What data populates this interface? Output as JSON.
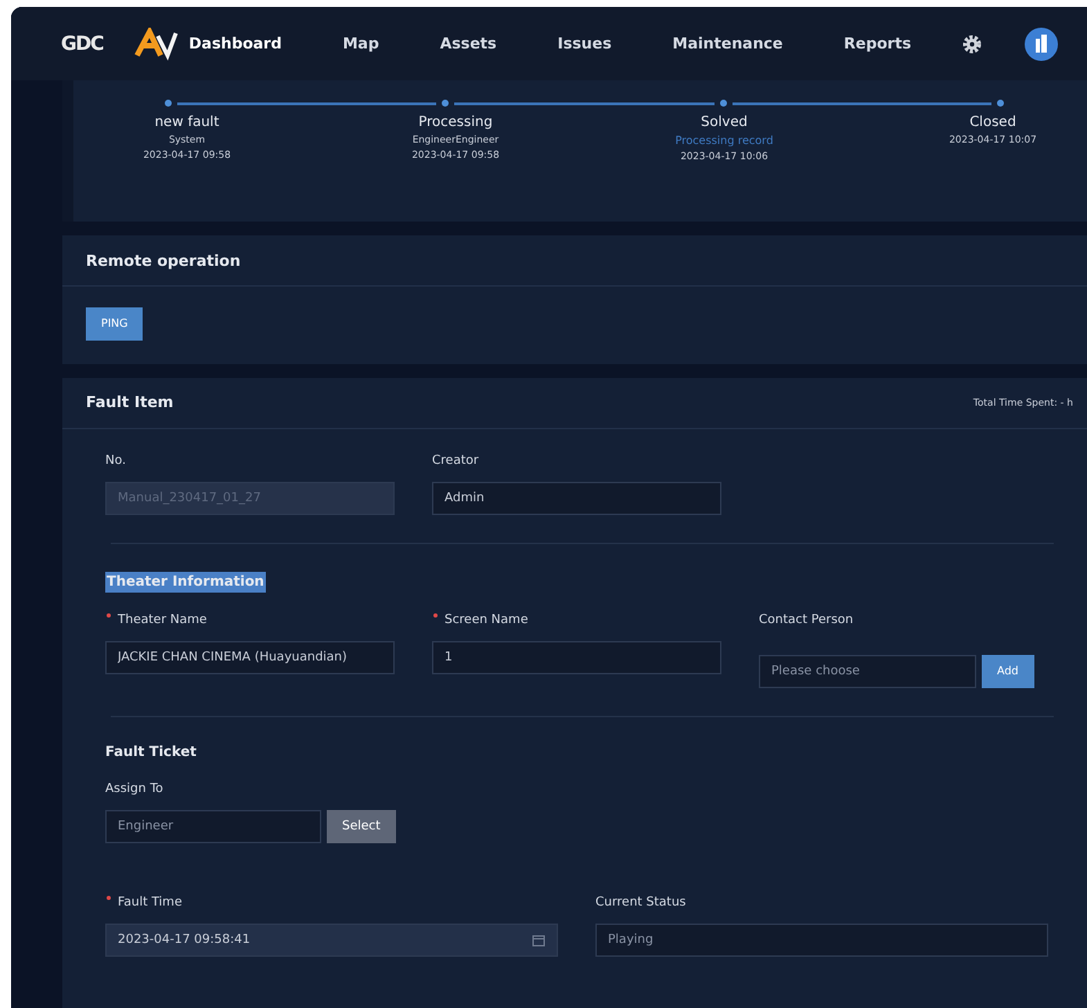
{
  "nav": {
    "brand": "GDC",
    "items": [
      {
        "label": "Dashboard",
        "selected": true
      },
      {
        "label": "Map",
        "selected": false
      },
      {
        "label": "Assets",
        "selected": false
      },
      {
        "label": "Issues",
        "selected": false
      },
      {
        "label": "Maintenance",
        "selected": false
      },
      {
        "label": "Reports",
        "selected": false
      }
    ]
  },
  "steps": [
    {
      "title": "new fault",
      "subtitle": "System",
      "time": "2023-04-17 09:58"
    },
    {
      "title": "Processing",
      "subtitle": "EngineerEngineer",
      "time": "2023-04-17 09:58"
    },
    {
      "title": "Solved",
      "link": "Processing record",
      "time": "2023-04-17 10:06"
    },
    {
      "title": "Closed",
      "time": "2023-04-17 10:07"
    }
  ],
  "remote_operation": {
    "title": "Remote operation",
    "buttons": [
      "PING"
    ]
  },
  "fault_item": {
    "title": "Fault Item",
    "total_time": "Total Time Spent: - h",
    "general": [
      {
        "label": "No.",
        "value": "Manual_230417_01_27",
        "disabled": true,
        "required": false
      },
      {
        "label": "Creator",
        "value": "Admin",
        "disabled": false,
        "required": false
      }
    ],
    "theater_heading": "Theater Information",
    "theater": [
      {
        "label": "Theater Name",
        "value": "JACKIE CHAN CINEMA (Huayuandian)",
        "required": true
      },
      {
        "label": "Screen Name",
        "value": "1",
        "required": true
      },
      {
        "label": "Contact Person",
        "placeholder": "Please choose",
        "required": false,
        "button": "Add"
      }
    ],
    "ticket_heading": "Fault Ticket",
    "assign": {
      "label": "Assign To",
      "placeholder": "Engineer",
      "button": "Select"
    },
    "bottom": [
      {
        "label": "Fault Time",
        "value": "2023-04-17 09:58:41",
        "required": true,
        "kind": "date"
      },
      {
        "label": "Current Status",
        "placeholder": "Playing",
        "required": false,
        "kind": "text"
      }
    ]
  }
}
